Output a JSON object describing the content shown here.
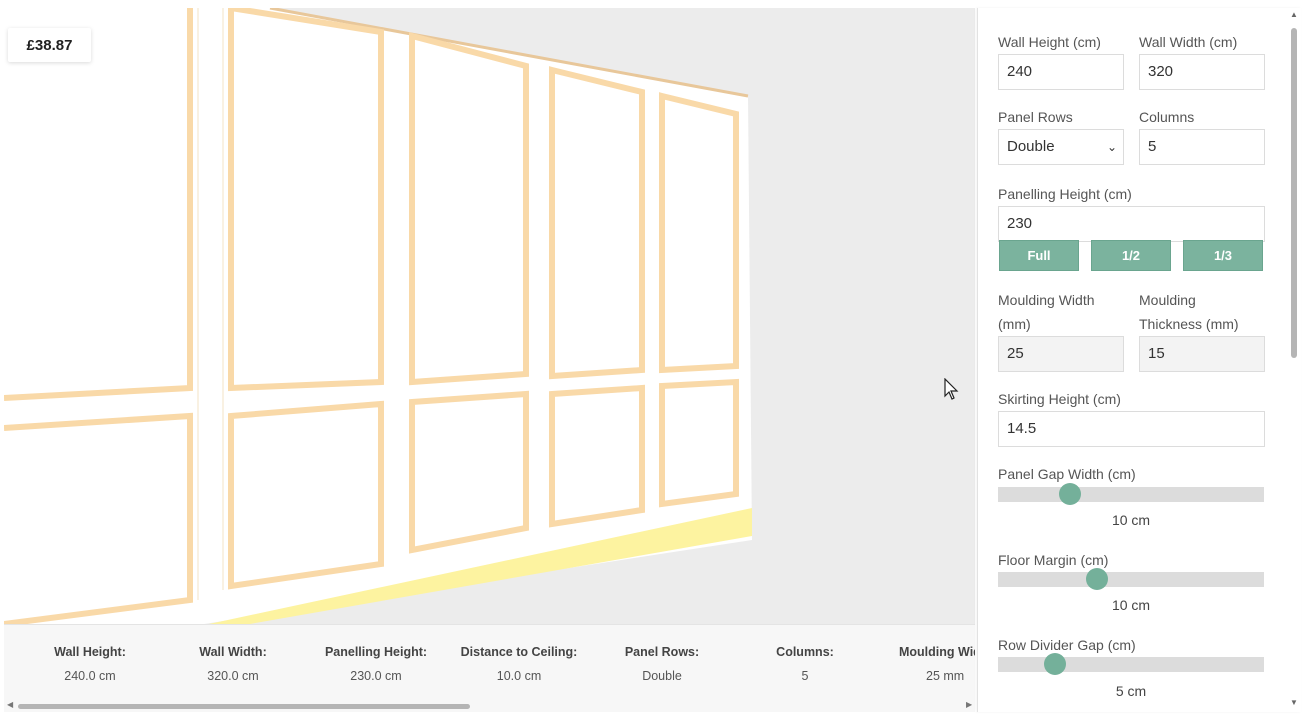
{
  "price": "£38.87",
  "form": {
    "wall_height_label": "Wall Height (cm)",
    "wall_height_value": "240",
    "wall_width_label": "Wall Width (cm)",
    "wall_width_value": "320",
    "panel_rows_label": "Panel Rows",
    "panel_rows_value": "Double",
    "columns_label": "Columns",
    "columns_value": "5",
    "panelling_height_label": "Panelling Height (cm)",
    "panelling_height_value": "230",
    "buttons": {
      "full": "Full",
      "half": "1/2",
      "third": "1/3"
    },
    "moulding_width_label_1": "Moulding Width",
    "moulding_width_label_2": "(mm)",
    "moulding_width_value": "25",
    "moulding_thickness_label_1": "Moulding",
    "moulding_thickness_label_2": "Thickness (mm)",
    "moulding_thickness_value": "15",
    "skirting_height_label": "Skirting Height (cm)",
    "skirting_height_value": "14.5",
    "panel_gap_label": "Panel Gap Width (cm)",
    "panel_gap_value": "10 cm",
    "panel_gap_level": 0.25,
    "floor_margin_label": "Floor Margin (cm)",
    "floor_margin_value": "10 cm",
    "floor_margin_level": 0.36,
    "row_divider_label": "Row Divider Gap (cm)",
    "row_divider_value": "5 cm",
    "row_divider_level": 0.19
  },
  "summary": [
    {
      "label": "Wall Height:",
      "value": "240.0 cm"
    },
    {
      "label": "Wall Width:",
      "value": "320.0 cm"
    },
    {
      "label": "Panelling Height:",
      "value": "230.0 cm"
    },
    {
      "label": "Distance to Ceiling:",
      "value": "10.0 cm"
    },
    {
      "label": "Panel Rows:",
      "value": "Double"
    },
    {
      "label": "Columns:",
      "value": "5"
    },
    {
      "label": "Moulding Wid",
      "value": "25 mm"
    }
  ],
  "colors": {
    "accent": "#7bb39e",
    "moulding": "#f9d9a8",
    "skirting": "#fdf3a0",
    "viewport_bg": "#ececec"
  },
  "icons": {
    "cursor": "mouse-pointer-icon",
    "dropdown": "chevron-down-icon"
  }
}
